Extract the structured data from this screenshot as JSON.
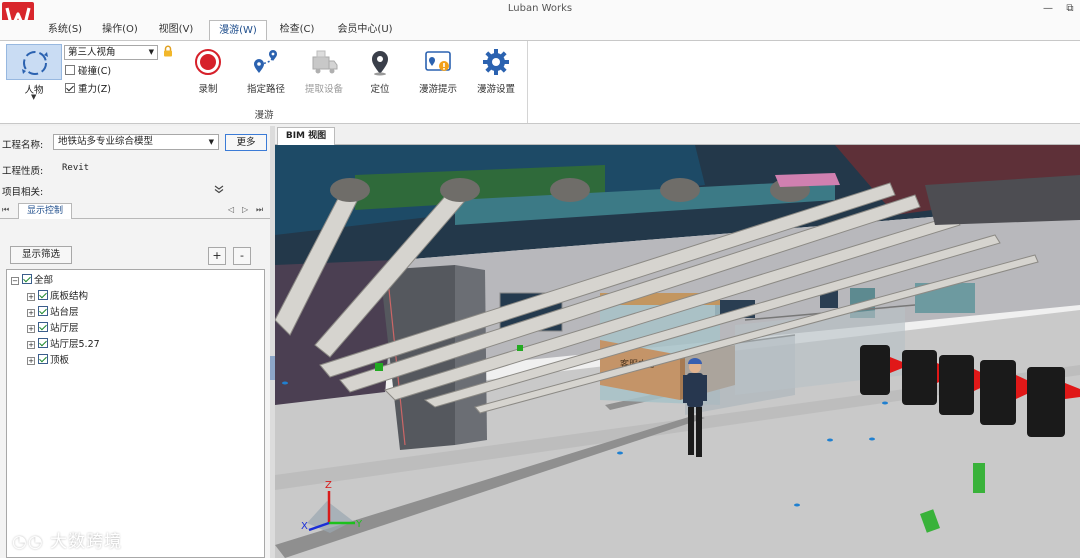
{
  "app": {
    "title": "Luban Works"
  },
  "menu": {
    "tabs": [
      {
        "label": "系统(S)"
      },
      {
        "label": "操作(O)"
      },
      {
        "label": "视图(V)"
      },
      {
        "label": "漫游(W)"
      },
      {
        "label": "检查(C)"
      },
      {
        "label": "会员中心(U)"
      }
    ],
    "active_index": 3
  },
  "ribbon": {
    "person": {
      "label": "人物"
    },
    "view_mode": {
      "selected": "第三人视角"
    },
    "collision": {
      "label": "碰撞(C)",
      "checked": false
    },
    "gravity": {
      "label": "重力(Z)",
      "checked": true
    },
    "buttons": [
      {
        "label": "录制",
        "icon": "record-icon",
        "enabled": true
      },
      {
        "label": "指定路径",
        "icon": "route-icon",
        "enabled": true
      },
      {
        "label": "提取设备",
        "icon": "extract-device-icon",
        "enabled": false
      },
      {
        "label": "定位",
        "icon": "location-pin-icon",
        "enabled": true
      },
      {
        "label": "漫游提示",
        "icon": "roam-tips-icon",
        "enabled": true
      },
      {
        "label": "漫游设置",
        "icon": "gear-icon",
        "enabled": true
      }
    ],
    "group_label": "漫游"
  },
  "left_panel": {
    "project_name_label": "工程名称:",
    "project_name_value": "地铁站多专业综合模型",
    "more_button": "更多",
    "project_type_label": "工程性质:",
    "project_type_value": "Revit",
    "project_related_label": "项目相关:",
    "display_tab": "显示控制",
    "filter_button": "显示筛选",
    "add_button": "+",
    "remove_button": "-",
    "tree": {
      "root": {
        "label": "全部",
        "checked": true
      },
      "children": [
        {
          "label": "底板结构",
          "checked": true
        },
        {
          "label": "站台层",
          "checked": true
        },
        {
          "label": "站厅层",
          "checked": true
        },
        {
          "label": "站厅层5.27",
          "checked": true
        },
        {
          "label": "顶板",
          "checked": true
        }
      ]
    }
  },
  "viewport": {
    "tab_label": "BIM 视图",
    "scene_sign": "客服中心",
    "axes": {
      "x": "X",
      "y": "Y",
      "z": "Z"
    }
  },
  "watermark": "大数跨境",
  "colors": {
    "accent": "#1f4e8c",
    "logo_red": "#d8262c",
    "record_red": "#d6202a",
    "icon_blue": "#2b62b0",
    "floor": "#c9c9c9"
  }
}
